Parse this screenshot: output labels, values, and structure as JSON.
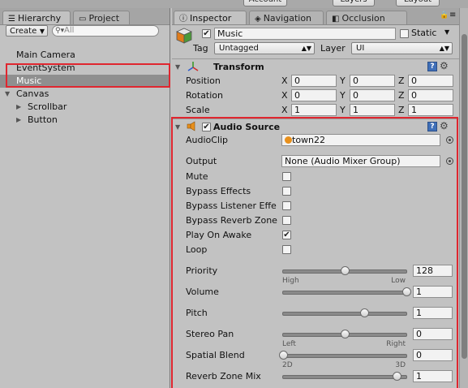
{
  "toolbar": {
    "left_button": "Account",
    "right_buttons": [
      "Layers",
      "Layout"
    ]
  },
  "hierarchy": {
    "tabs": [
      {
        "label": "Hierarchy",
        "icon": "list-icon",
        "active": true
      },
      {
        "label": "Project",
        "icon": "folder-icon",
        "active": false
      }
    ],
    "create_label": "Create",
    "search_placeholder": "All",
    "items": [
      {
        "label": "Main Camera",
        "indent": 0,
        "expander": ""
      },
      {
        "label": "EventSystem",
        "indent": 0,
        "expander": ""
      },
      {
        "label": "Music",
        "indent": 0,
        "expander": "",
        "selected": true
      },
      {
        "label": "Canvas",
        "indent": 0,
        "expander": "▼"
      },
      {
        "label": "Scrollbar",
        "indent": 1,
        "expander": "▶"
      },
      {
        "label": "Button",
        "indent": 1,
        "expander": "▶"
      }
    ]
  },
  "inspector": {
    "tabs": [
      {
        "label": "Inspector",
        "icon": "info-icon",
        "active": true
      },
      {
        "label": "Navigation",
        "icon": "navigation-icon",
        "active": false
      },
      {
        "label": "Occlusion",
        "icon": "occlusion-icon",
        "active": false
      }
    ],
    "object": {
      "active": true,
      "name": "Music",
      "static_label": "Static",
      "static_checked": false,
      "tag_label": "Tag",
      "tag_value": "Untagged",
      "layer_label": "Layer",
      "layer_value": "UI"
    },
    "transform": {
      "title": "Transform",
      "rows": [
        {
          "label": "Position",
          "x": "0",
          "y": "0",
          "z": "0"
        },
        {
          "label": "Rotation",
          "x": "0",
          "y": "0",
          "z": "0"
        },
        {
          "label": "Scale",
          "x": "1",
          "y": "1",
          "z": "1"
        }
      ],
      "axis_labels": [
        "X",
        "Y",
        "Z"
      ]
    },
    "audio_source": {
      "title": "Audio Source",
      "enabled": true,
      "audio_clip_label": "AudioClip",
      "audio_clip_value": "town22",
      "output_label": "Output",
      "output_value": "None (Audio Mixer Group)",
      "checkboxes": [
        {
          "label": "Mute",
          "checked": false
        },
        {
          "label": "Bypass Effects",
          "checked": false
        },
        {
          "label": "Bypass Listener Effe",
          "checked": false
        },
        {
          "label": "Bypass Reverb Zone",
          "checked": false
        },
        {
          "label": "Play On Awake",
          "checked": true
        },
        {
          "label": "Loop",
          "checked": false
        }
      ],
      "sliders": [
        {
          "label": "Priority",
          "value": "128",
          "fraction": 0.5,
          "left": "High",
          "right": "Low"
        },
        {
          "label": "Volume",
          "value": "1",
          "fraction": 1.0,
          "left": "",
          "right": ""
        },
        {
          "label": "Pitch",
          "value": "1",
          "fraction": 0.66,
          "left": "",
          "right": ""
        },
        {
          "label": "Stereo Pan",
          "value": "0",
          "fraction": 0.5,
          "left": "Left",
          "right": "Right"
        },
        {
          "label": "Spatial Blend",
          "value": "0",
          "fraction": 0.0,
          "left": "2D",
          "right": "3D"
        },
        {
          "label": "Reverb Zone Mix",
          "value": "1",
          "fraction": 0.92,
          "left": "",
          "right": ""
        }
      ]
    }
  },
  "colors": {
    "panel": "#c2c2c2",
    "selection": "#8f8f8f",
    "highlight_box": "#e0262f",
    "checkbox_check": "#222222"
  }
}
